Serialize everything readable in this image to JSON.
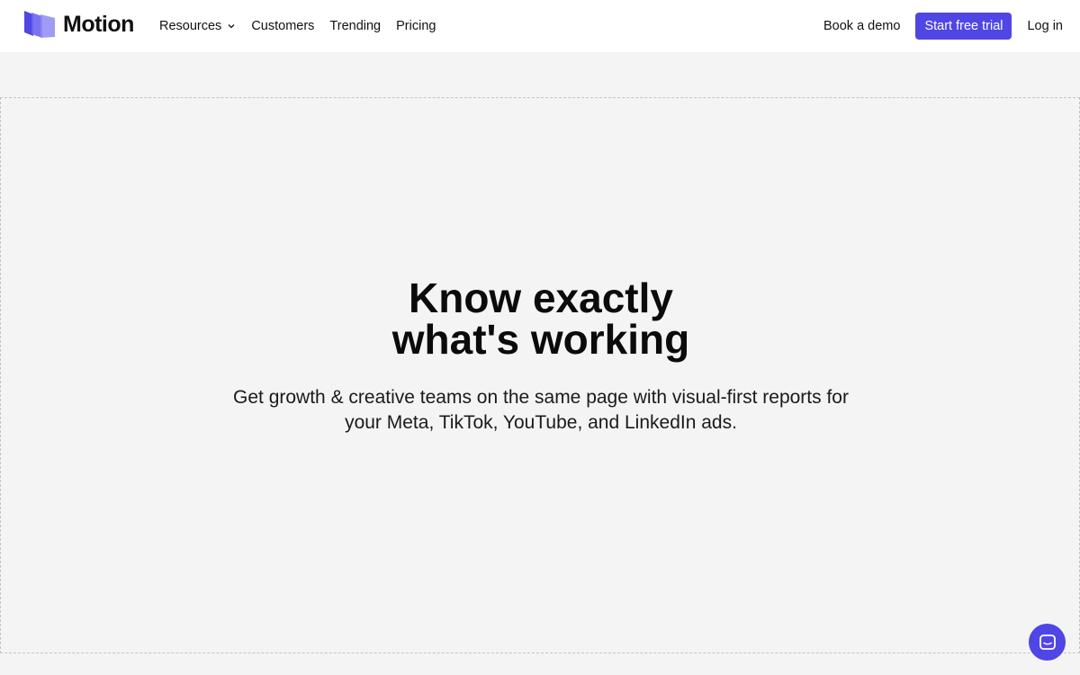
{
  "brand": {
    "name": "Motion",
    "color": "#4f46e5"
  },
  "nav": {
    "links": [
      {
        "label": "Resources",
        "has_dropdown": true
      },
      {
        "label": "Customers"
      },
      {
        "label": "Trending"
      },
      {
        "label": "Pricing"
      }
    ],
    "book_demo": "Book a demo",
    "start_trial": "Start free trial",
    "login": "Log in"
  },
  "hero": {
    "title_line1": "Know exactly",
    "title_line2": "what's working",
    "subtitle": "Get growth & creative teams on the same page with visual-first reports for your Meta, TikTok, YouTube, and LinkedIn ads."
  },
  "icons": {
    "logo": "motion-logo-icon",
    "dropdown": "chevron-down-icon",
    "chat": "chat-icon"
  }
}
